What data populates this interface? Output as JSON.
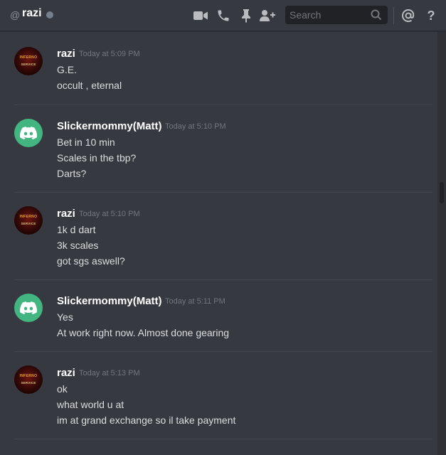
{
  "header": {
    "at_symbol": "@",
    "channel_name": "razi",
    "status": "offline",
    "search_placeholder": "Search",
    "icons": [
      "video-call-icon",
      "voice-call-icon",
      "pin-icon",
      "add-friend-icon",
      "search-icon",
      "mentions-icon",
      "help-icon"
    ],
    "help_symbol": "?"
  },
  "colors": {
    "background": "#36393f",
    "username": "#ffffff",
    "timestamp": "#72767d",
    "discord_avatar": "#43b581",
    "offline_status": "#747f8d"
  },
  "messages": [
    {
      "author": "razi",
      "avatar": "razi",
      "avatar_text_top": "INFERNO",
      "avatar_text_bottom": "SERVICE",
      "timestamp": "Today at 5:09 PM",
      "lines": [
        "G.E.",
        "occult , eternal"
      ]
    },
    {
      "author": "Slickermommy(Matt)",
      "avatar": "discord",
      "timestamp": "Today at 5:10 PM",
      "lines": [
        "Bet in 10 min",
        "Scales in the tbp?",
        "Darts?"
      ]
    },
    {
      "author": "razi",
      "avatar": "razi",
      "avatar_text_top": "INFERNO",
      "avatar_text_bottom": "SERVICE",
      "timestamp": "Today at 5:10 PM",
      "lines": [
        "1k d dart",
        "3k scales",
        "got sgs aswell?"
      ]
    },
    {
      "author": "Slickermommy(Matt)",
      "avatar": "discord",
      "timestamp": "Today at 5:11 PM",
      "lines": [
        "Yes",
        "At work right now. Almost done gearing"
      ]
    },
    {
      "author": "razi",
      "avatar": "razi",
      "avatar_text_top": "INFERNO",
      "avatar_text_bottom": "SERVICE",
      "timestamp": "Today at 5:13 PM",
      "lines": [
        "ok",
        "what world u at",
        "im at grand exchange so il take payment"
      ]
    }
  ]
}
